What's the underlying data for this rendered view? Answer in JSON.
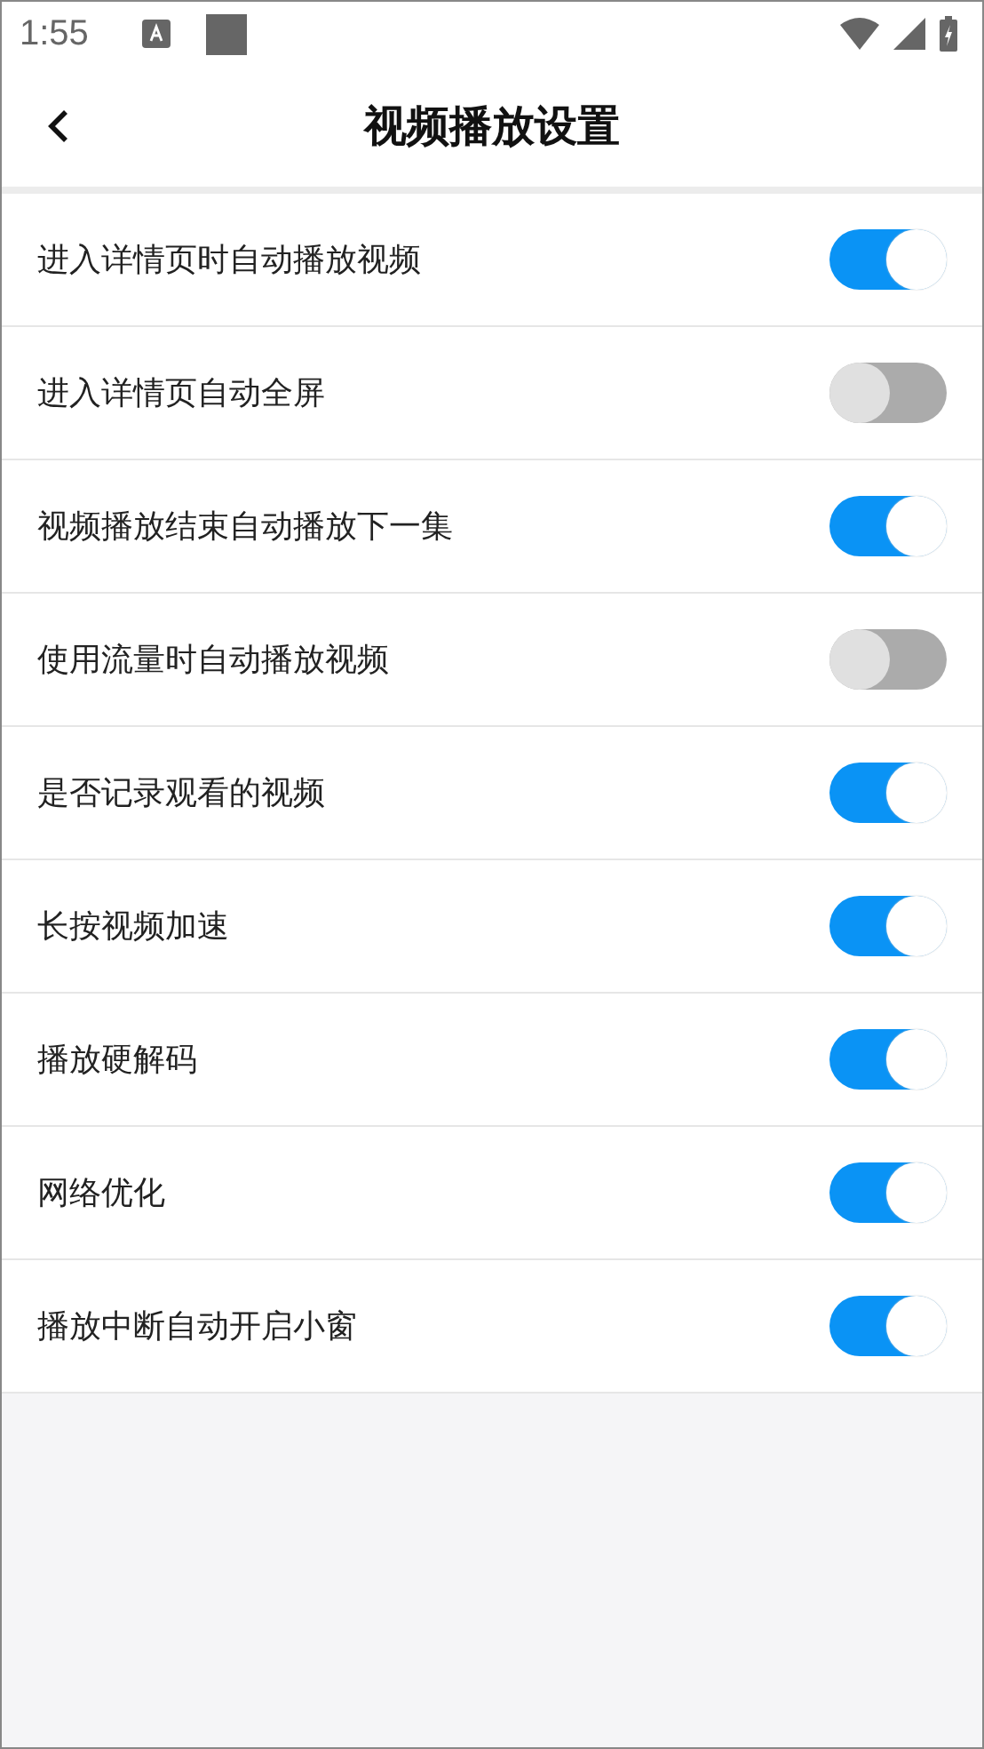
{
  "status_bar": {
    "time": "1:55"
  },
  "header": {
    "title": "视频播放设置"
  },
  "settings": [
    {
      "label": "进入详情页时自动播放视频",
      "on": true
    },
    {
      "label": "进入详情页自动全屏",
      "on": false
    },
    {
      "label": "视频播放结束自动播放下一集",
      "on": true
    },
    {
      "label": "使用流量时自动播放视频",
      "on": false
    },
    {
      "label": "是否记录观看的视频",
      "on": true
    },
    {
      "label": "长按视频加速",
      "on": true
    },
    {
      "label": "播放硬解码",
      "on": true
    },
    {
      "label": "网络优化",
      "on": true
    },
    {
      "label": "播放中断自动开启小窗",
      "on": true
    }
  ]
}
